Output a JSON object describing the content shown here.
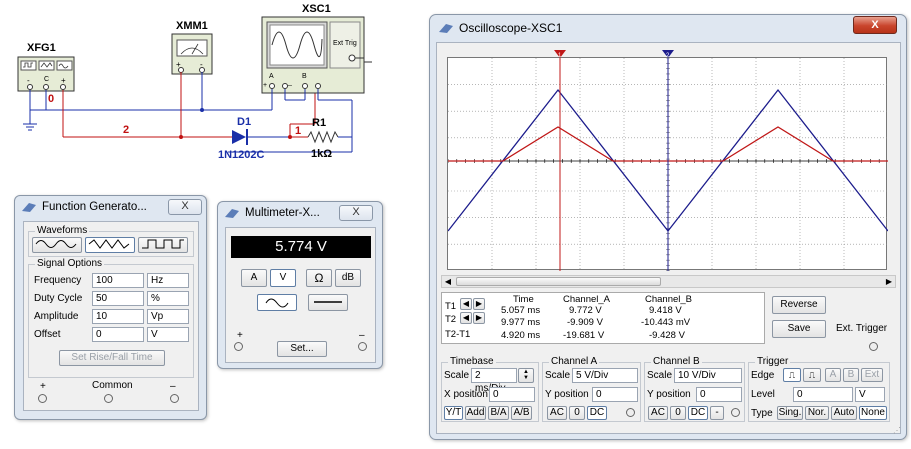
{
  "schematic": {
    "xfg_label": "XFG1",
    "xmm_label": "XMM1",
    "xsc_label": "XSC1",
    "ext_trig": "Ext Trig",
    "diode_ref": "D1",
    "diode_model": "1N1202C",
    "resistor_ref": "R1",
    "resistor_value": "1kΩ",
    "net_0": "0",
    "net_1": "1",
    "net_2": "2",
    "scope_a": "A",
    "scope_b": "B",
    "plus": "+",
    "minus": "_",
    "xmm_plus": "+",
    "xmm_minus": "-",
    "xfg_minus": "-",
    "xfg_plus": "+",
    "xfg_common": "C"
  },
  "function_generator": {
    "title": "Function Generato...",
    "close": "X",
    "waveforms_label": "Waveforms",
    "signal_options_label": "Signal Options",
    "rows": [
      {
        "label": "Frequency",
        "value": "100",
        "unit": "Hz"
      },
      {
        "label": "Duty Cycle",
        "value": "50",
        "unit": "%"
      },
      {
        "label": "Amplitude",
        "value": "10",
        "unit": "Vp"
      },
      {
        "label": "Offset",
        "value": "0",
        "unit": "V"
      }
    ],
    "set_rise_fall": "Set Rise/Fall Time",
    "plus": "+",
    "common": "Common",
    "minus": "–"
  },
  "multimeter": {
    "title": "Multimeter-X...",
    "close": "X",
    "reading": "5.774 V",
    "modes": [
      "A",
      "V",
      "Ω",
      "dB"
    ],
    "plus": "+",
    "minus": "–",
    "set": "Set..."
  },
  "oscilloscope": {
    "title": "Oscilloscope-XSC1",
    "close": "X",
    "table_headers": [
      "Time",
      "Channel_A",
      "Channel_B"
    ],
    "t1": {
      "label": "T1",
      "time": "5.057 ms",
      "a": "9.772 V",
      "b": "9.418 V"
    },
    "t2": {
      "label": "T2",
      "time": "9.977 ms",
      "a": "-9.909 V",
      "b": "-10.443 mV"
    },
    "t2t1": {
      "label": "T2-T1",
      "time": "4.920 ms",
      "a": "-19.681 V",
      "b": "-9.428 V"
    },
    "reverse": "Reverse",
    "save": "Save",
    "ext_trigger": "Ext. Trigger",
    "timebase": {
      "title": "Timebase",
      "scale_label": "Scale",
      "scale": "2 ms/Div",
      "xpos_label": "X position",
      "xpos": "0",
      "buttons": [
        "Y/T",
        "Add",
        "B/A",
        "A/B"
      ]
    },
    "channel_a": {
      "title": "Channel A",
      "scale_label": "Scale",
      "scale": "5  V/Div",
      "ypos_label": "Y position",
      "ypos": "0",
      "buttons": [
        "AC",
        "0",
        "DC"
      ]
    },
    "channel_b": {
      "title": "Channel B",
      "scale_label": "Scale",
      "scale": "10  V/Div",
      "ypos_label": "Y position",
      "ypos": "0",
      "buttons": [
        "AC",
        "0",
        "DC",
        "-"
      ]
    },
    "trigger": {
      "title": "Trigger",
      "edge_label": "Edge",
      "edge_buttons": [
        "A",
        "B",
        "Ext"
      ],
      "level_label": "Level",
      "level": "0",
      "level_unit": "V",
      "type_label": "Type",
      "type_buttons": [
        "Sing.",
        "Nor.",
        "Auto",
        "None"
      ]
    },
    "traces": {
      "channel_a_color": "#c01818",
      "channel_b_color": "#1c1c8c"
    }
  }
}
